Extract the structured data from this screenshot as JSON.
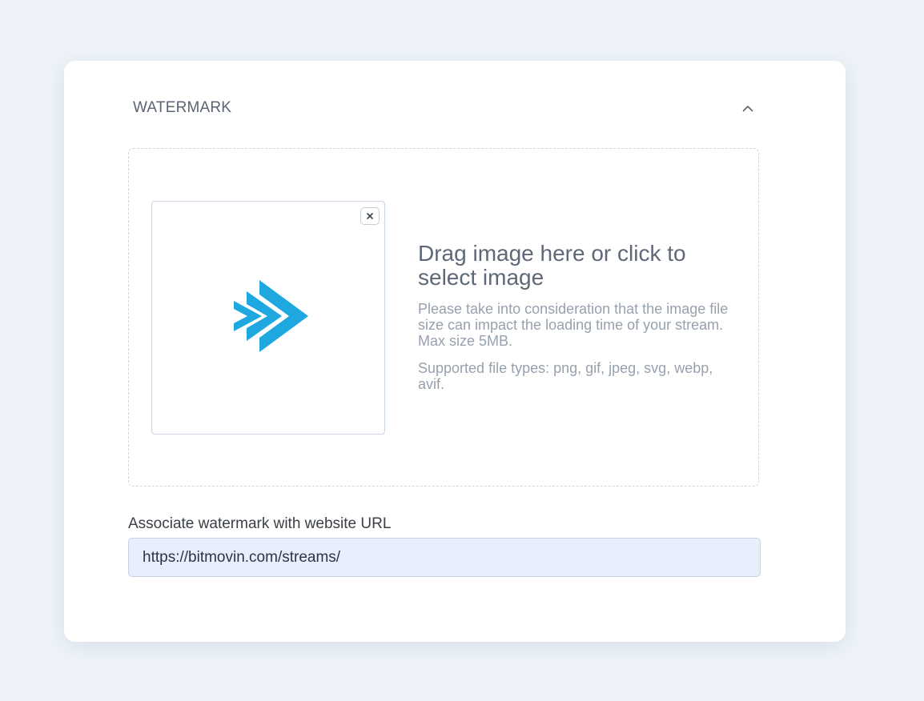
{
  "section": {
    "title": "WATERMARK",
    "collapse_icon": "chevron-up-icon"
  },
  "dropzone": {
    "title": "Drag image here or click to select image",
    "size_hint": "Please take into consideration that the image file size can impact the loading time of your stream. Max size 5MB.",
    "types_hint": "Supported file types: png, gif, jpeg, svg, webp, avif.",
    "remove_icon": "close-icon",
    "preview_image": "bitmovin-logo",
    "accent_color": "#1fa8e0"
  },
  "url_field": {
    "label": "Associate watermark with website URL",
    "value": "https://bitmovin.com/streams/"
  }
}
